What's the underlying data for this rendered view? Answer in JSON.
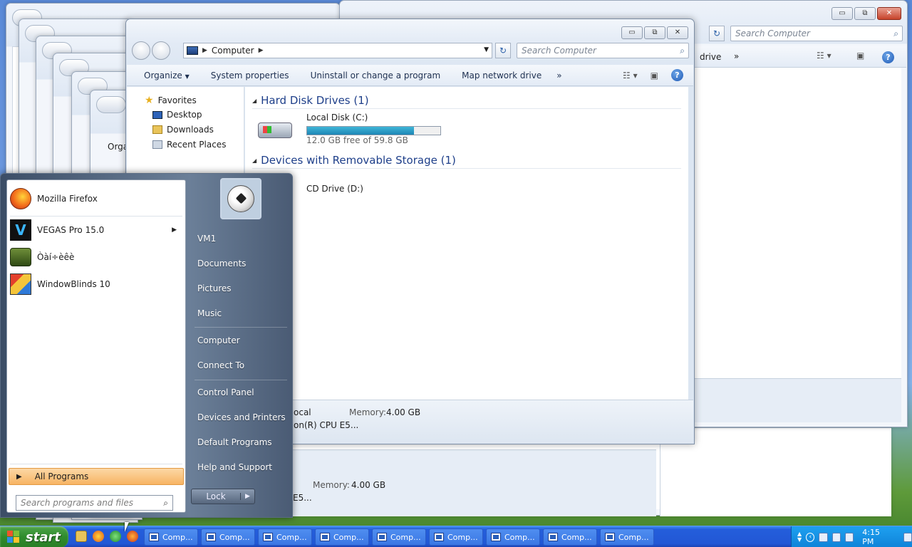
{
  "main_window": {
    "address_path": "Computer",
    "search_placeholder": "Search Computer",
    "title_buttons": {
      "min": "▭",
      "max": "⧉",
      "close": "✕"
    },
    "toolbar": [
      "Organize",
      "System properties",
      "Uninstall or change a program",
      "Map network drive",
      "»"
    ],
    "nav": {
      "favorites": "Favorites",
      "items": [
        "Desktop",
        "Downloads",
        "Recent Places"
      ]
    },
    "groups": {
      "hdd_header": "Hard Disk Drives (1)",
      "disk_name": "Local Disk (C:)",
      "disk_free": "12.0 GB free of 59.8 GB",
      "disk_used_fraction": 0.8,
      "removable_header": "Devices with Removable Storage (1)",
      "cd_name": "CD Drive (D:)"
    },
    "details": {
      "col1_line1": "ocal",
      "col1_line2": "on(R) CPU E5...",
      "memory_label": "Memory:",
      "memory_value": "4.00 GB"
    }
  },
  "right_window": {
    "search_placeholder": "Search Computer",
    "toolbar_partial": "drive",
    "toolbar_more": "»"
  },
  "behind_window": {
    "memory_label": "Memory:",
    "memory_value": "4.00 GB",
    "cpu_partial": "E5...",
    "org_partial": "Orga"
  },
  "start_menu": {
    "programs": [
      {
        "label": "Mozilla Firefox",
        "has_submenu": false
      },
      {
        "label": "VEGAS Pro 15.0",
        "has_submenu": true
      },
      {
        "label": "Òàí÷èêè",
        "has_submenu": false
      },
      {
        "label": "WindowBlinds 10",
        "has_submenu": false
      }
    ],
    "all_programs": "All Programs",
    "search_placeholder": "Search programs and files",
    "right_links": [
      "VM1",
      "Documents",
      "Pictures",
      "Music",
      "Computer",
      "Connect To",
      "Control Panel",
      "Devices and Printers",
      "Default Programs",
      "Help and Support"
    ],
    "lock": "Lock"
  },
  "taskbar": {
    "start": "start",
    "tasks": [
      "Comp...",
      "Comp...",
      "Comp...",
      "Comp...",
      "Comp...",
      "Comp...",
      "Comp...",
      "Comp...",
      "Comp..."
    ],
    "clock": "4:15 PM"
  },
  "colors": {
    "accent": "#1e3f8a",
    "taskbar_blue": "#2257d5",
    "start_green": "#2f8b2c",
    "all_programs_orange": "#f7b463"
  }
}
